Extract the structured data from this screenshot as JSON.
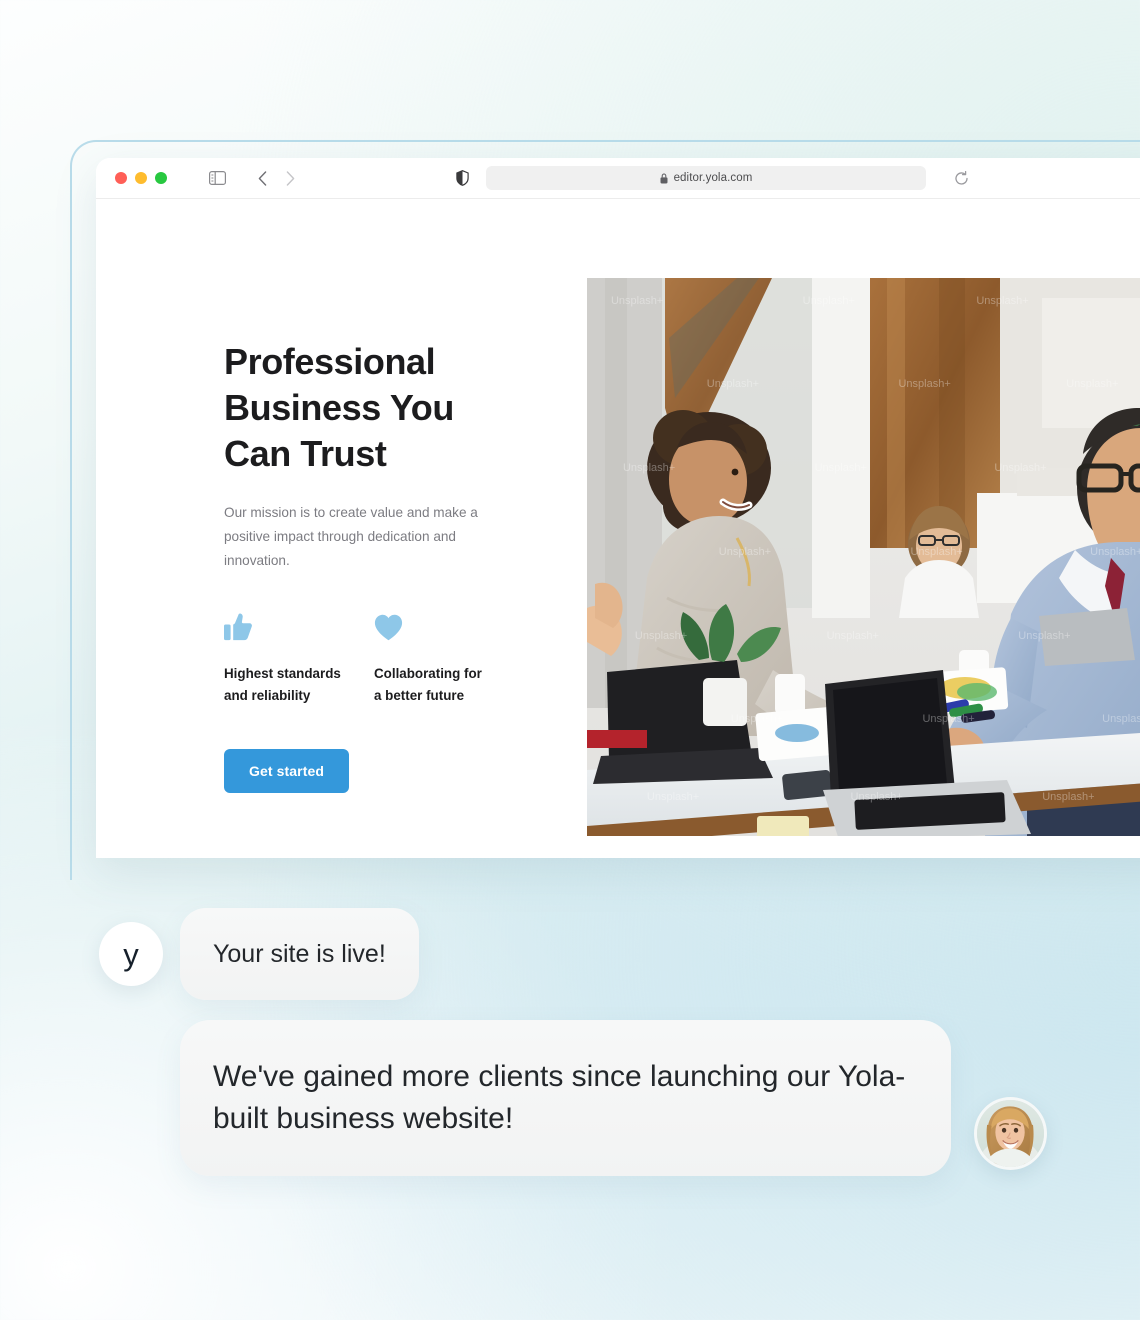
{
  "browser": {
    "traffic_lights": [
      "close",
      "minimize",
      "maximize"
    ],
    "sidebar_toggle_label": "Show Sidebar",
    "back_label": "Back",
    "forward_label": "Forward",
    "shield_label": "Privacy Report",
    "url": "editor.yola.com",
    "lock_label": "Secure connection",
    "reload_label": "Reload"
  },
  "site": {
    "headline": "Professional\nBusiness You\nCan Trust",
    "subhead": "Our mission is to create value and make a positive impact through dedication and innovation.",
    "features": [
      {
        "icon": "thumbs-up-icon",
        "label": "Highest standards\nand reliability"
      },
      {
        "icon": "heart-icon",
        "label": "Collaborating for\na better future"
      }
    ],
    "cta_label": "Get started",
    "hero_image_alt": "Two business professionals shaking hands in a modern office meeting room",
    "hero_watermark": "Unsplash+"
  },
  "chat": {
    "brand_avatar_letter": "y",
    "messages": [
      {
        "id": "site-live",
        "text": "Your site is live!"
      },
      {
        "id": "testimonial",
        "text": "We've gained more clients since launching our Yola-built business website!"
      }
    ],
    "person_avatar_alt": "Smiling woman portrait"
  },
  "colors": {
    "accent_blue": "#3498db",
    "icon_blue": "#8ec7e8",
    "frame_blue": "#b9dcea",
    "headline": "#1c1c1e",
    "body_text": "#7c7c82",
    "bubble_bg": "#f4f5f5"
  }
}
